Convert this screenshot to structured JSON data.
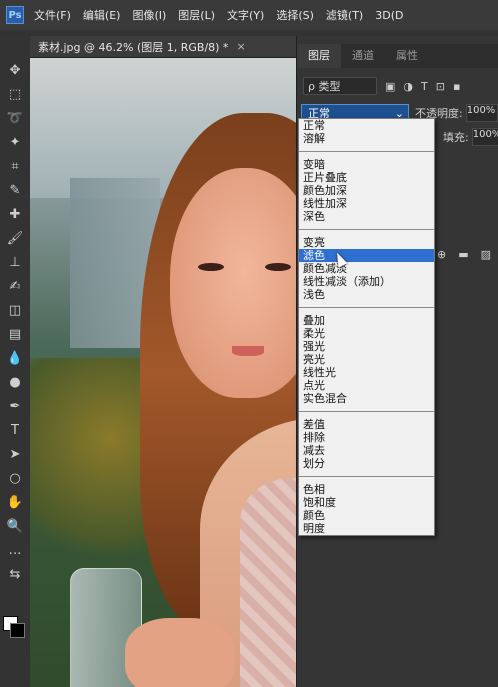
{
  "menubar": {
    "logo": "Ps",
    "items": [
      "文件(F)",
      "编辑(E)",
      "图像(I)",
      "图层(L)",
      "文字(Y)",
      "选择(S)",
      "滤镜(T)",
      "3D(D"
    ]
  },
  "document_tab": {
    "title": "素材.jpg @ 46.2% (图层 1, RGB/8) *",
    "close": "×"
  },
  "toolbar": {
    "tools": [
      "move-icon",
      "marquee-icon",
      "lasso-icon",
      "magic-wand-icon",
      "crop-icon",
      "eyedropper-icon",
      "healing-icon",
      "brush-icon",
      "stamp-icon",
      "history-brush-icon",
      "eraser-icon",
      "gradient-icon",
      "blur-icon",
      "dodge-icon",
      "pen-icon",
      "type-icon",
      "path-select-icon",
      "shape-icon",
      "hand-icon",
      "zoom-icon",
      "more-icon",
      "swap-colors-icon"
    ],
    "glyphs": [
      "✥",
      "⬚",
      "➰",
      "✦",
      "⌗",
      "✎",
      "✚",
      "🖌",
      "⊥",
      "✍",
      "◫",
      "▤",
      "💧",
      "●",
      "✒",
      "T",
      "➤",
      "○",
      "✋",
      "🔍",
      "…",
      "⇆"
    ]
  },
  "layers_panel": {
    "tabs": [
      "图层",
      "通道",
      "属性"
    ],
    "active_tab": 0,
    "filter_label": "ρ 类型",
    "filter_icons": [
      "▣",
      "◑",
      "T",
      "⊡",
      "▪"
    ],
    "blend_mode": "正常",
    "opacity_label": "不透明度:",
    "opacity_value": "100%",
    "fill_label": "填充:",
    "fill_value": "100%",
    "bottom_icons": [
      "⊕",
      "▬",
      "▨",
      "▣"
    ]
  },
  "blend_dropdown": {
    "groups": [
      [
        "正常",
        "溶解"
      ],
      [
        "变暗",
        "正片叠底",
        "颜色加深",
        "线性加深",
        "深色"
      ],
      [
        "变亮",
        "滤色",
        "颜色减淡",
        "线性减淡（添加）",
        "浅色"
      ],
      [
        "叠加",
        "柔光",
        "强光",
        "亮光",
        "线性光",
        "点光",
        "实色混合"
      ],
      [
        "差值",
        "排除",
        "减去",
        "划分"
      ],
      [
        "色相",
        "饱和度",
        "颜色",
        "明度"
      ]
    ],
    "selected": "滤色"
  }
}
